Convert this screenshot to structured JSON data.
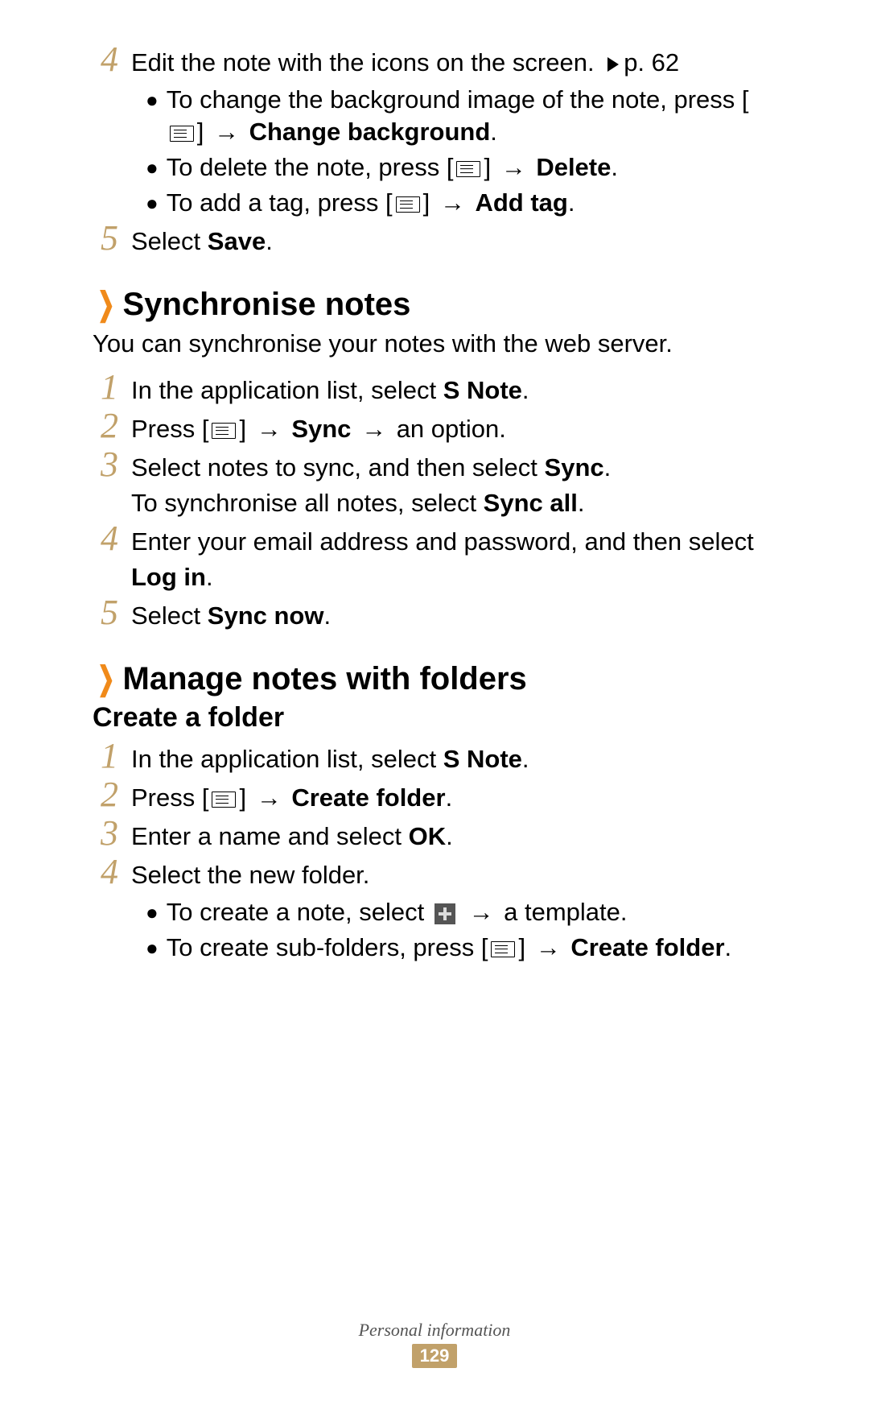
{
  "top_steps": [
    {
      "num": "4",
      "text_pre": "Edit the note with the icons on the screen. ",
      "page_ref": "p. 62",
      "bullets": [
        {
          "pre": "To change the background image of the note, press [",
          "post_icon": "] ",
          "arrow": "→ ",
          "bold": "Change background",
          "tail": "."
        },
        {
          "pre": "To delete the note, press [",
          "post_icon": "] ",
          "arrow": "→ ",
          "bold": "Delete",
          "tail": "."
        },
        {
          "pre": "To add a tag, press [",
          "post_icon": "] ",
          "arrow": "→ ",
          "bold": "Add tag",
          "tail": "."
        }
      ]
    },
    {
      "num": "5",
      "text_pre": "Select ",
      "bold": "Save",
      "tail": "."
    }
  ],
  "sync_section": {
    "title": "Synchronise notes",
    "desc": "You can synchronise your notes with the web server.",
    "steps": [
      {
        "num": "1",
        "pre": "In the application list, select ",
        "bold": "S Note",
        "tail": "."
      },
      {
        "num": "2",
        "pre": "Press [",
        "has_icon": true,
        "post_icon": "] ",
        "arrow1": "→ ",
        "bold": "Sync",
        "mid": " ",
        "arrow2": "→ ",
        "tail": "an option."
      },
      {
        "num": "3",
        "line1_pre": "Select notes to sync, and then select ",
        "line1_bold": "Sync",
        "line1_tail": ".",
        "line2_pre": "To synchronise all notes, select ",
        "line2_bold": "Sync all",
        "line2_tail": "."
      },
      {
        "num": "4",
        "pre": "Enter your email address and password, and then select ",
        "bold": "Log in",
        "tail": "."
      },
      {
        "num": "5",
        "pre": "Select ",
        "bold": "Sync now",
        "tail": "."
      }
    ]
  },
  "manage_section": {
    "title": "Manage notes with folders",
    "subheading": "Create a folder",
    "steps": [
      {
        "num": "1",
        "pre": "In the application list, select ",
        "bold": "S Note",
        "tail": "."
      },
      {
        "num": "2",
        "pre": "Press [",
        "has_icon": true,
        "post_icon": "] ",
        "arrow": "→ ",
        "bold": "Create folder",
        "tail": "."
      },
      {
        "num": "3",
        "pre": "Enter a name and select ",
        "bold": "OK",
        "tail": "."
      },
      {
        "num": "4",
        "pre": "Select the new folder.",
        "bullets": [
          {
            "pre": "To create a note, select ",
            "icon": "plus",
            "mid": " ",
            "arrow": "→ ",
            "tail": "a template."
          },
          {
            "pre": "To create sub-folders, press [",
            "icon": "menu",
            "post_icon": "] ",
            "arrow": "→ ",
            "bold": "Create folder",
            "tail": "."
          }
        ]
      }
    ]
  },
  "footer": {
    "category": "Personal information",
    "page": "129"
  }
}
